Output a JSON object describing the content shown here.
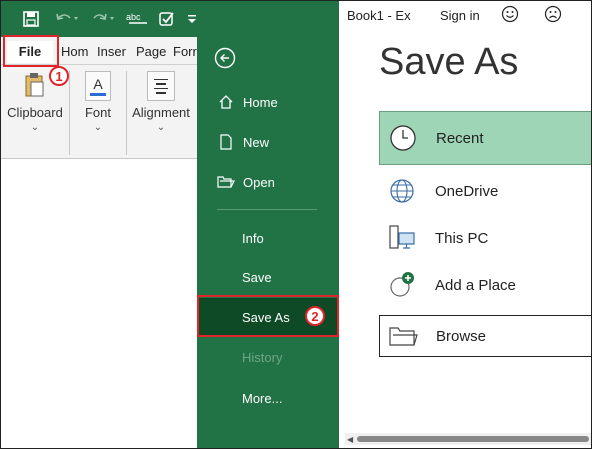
{
  "quick_access": {
    "icons": [
      "save-icon",
      "undo-icon",
      "redo-icon",
      "spelling-icon",
      "touch-mode-icon",
      "customize-icon"
    ]
  },
  "ribbon": {
    "tabs": [
      "File",
      "Hom",
      "Inser",
      "Page",
      "Forr"
    ],
    "groups": [
      {
        "label": "Clipboard",
        "icon": "clipboard-icon"
      },
      {
        "label": "Font",
        "icon": "font-color-icon"
      },
      {
        "label": "Alignment",
        "icon": "align-icon"
      }
    ]
  },
  "backstage": {
    "back_icon": "back-arrow-icon",
    "items": [
      {
        "label": "Home",
        "icon": "home-icon"
      },
      {
        "label": "New",
        "icon": "new-doc-icon"
      },
      {
        "label": "Open",
        "icon": "folder-open-icon"
      },
      {
        "label": "Info"
      },
      {
        "label": "Save"
      },
      {
        "label": "Save As"
      },
      {
        "label": "History"
      },
      {
        "label": "More..."
      }
    ]
  },
  "header": {
    "doc_title": "Book1 - Ex",
    "sign_in": "Sign in"
  },
  "save_as": {
    "title": "Save As",
    "locations": [
      "Recent",
      "OneDrive",
      "This PC",
      "Add a Place",
      "Browse"
    ]
  },
  "annotations": {
    "badge1": "1",
    "badge2": "2"
  },
  "colors": {
    "excel_green": "#217346",
    "dark_green": "#0e4a26",
    "recent_bg": "#9fd5b7",
    "highlight_red": "#e0242a"
  }
}
